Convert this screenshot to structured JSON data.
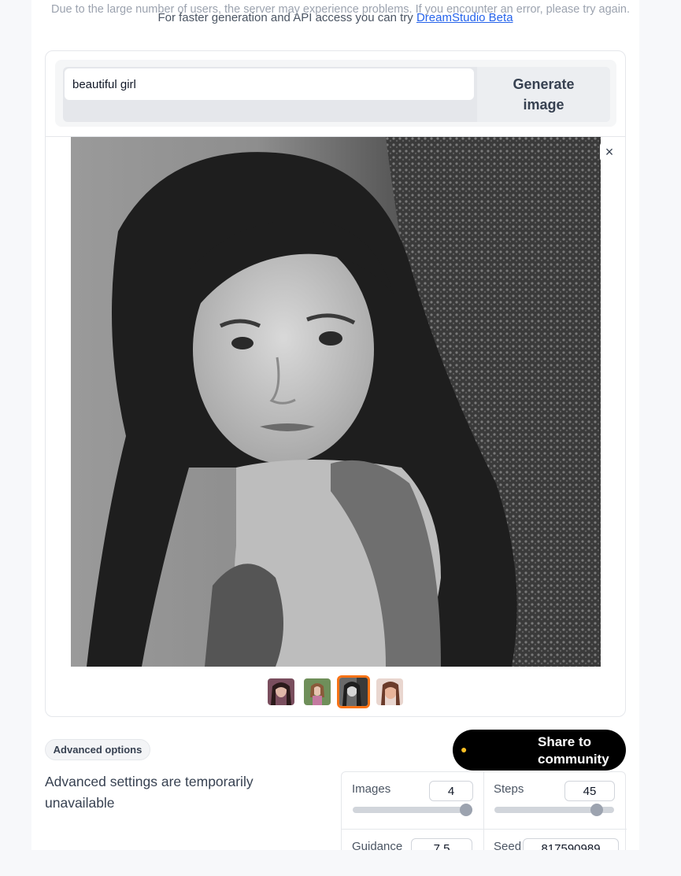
{
  "banner": {
    "text": "Due to the large number of users, the server may experience problems. If you encounter an error, please try again."
  },
  "subline": {
    "prefix": "For faster generation and API access you can try ",
    "link": "DreamStudio Beta"
  },
  "prompt": {
    "value": "beautiful girl",
    "button_label": "Generate image"
  },
  "gallery": {
    "close_label": "×",
    "thumbnail_count": 4,
    "selected_index": 2
  },
  "advanced": {
    "pill_label": "Advanced options",
    "message": "Advanced settings are temporarily unavailable"
  },
  "share": {
    "label": "Share to community"
  },
  "settings": {
    "images": {
      "label": "Images",
      "value": "4",
      "level": 1.0
    },
    "steps": {
      "label": "Steps",
      "value": "45",
      "level": 0.9
    },
    "guidance": {
      "label": "Guidance",
      "value": "7.5"
    },
    "seed": {
      "label": "Seed",
      "value": "817590989"
    }
  },
  "colors": {
    "accent_selected": "#f97316",
    "share_bg": "#000000",
    "link": "#2563eb"
  }
}
